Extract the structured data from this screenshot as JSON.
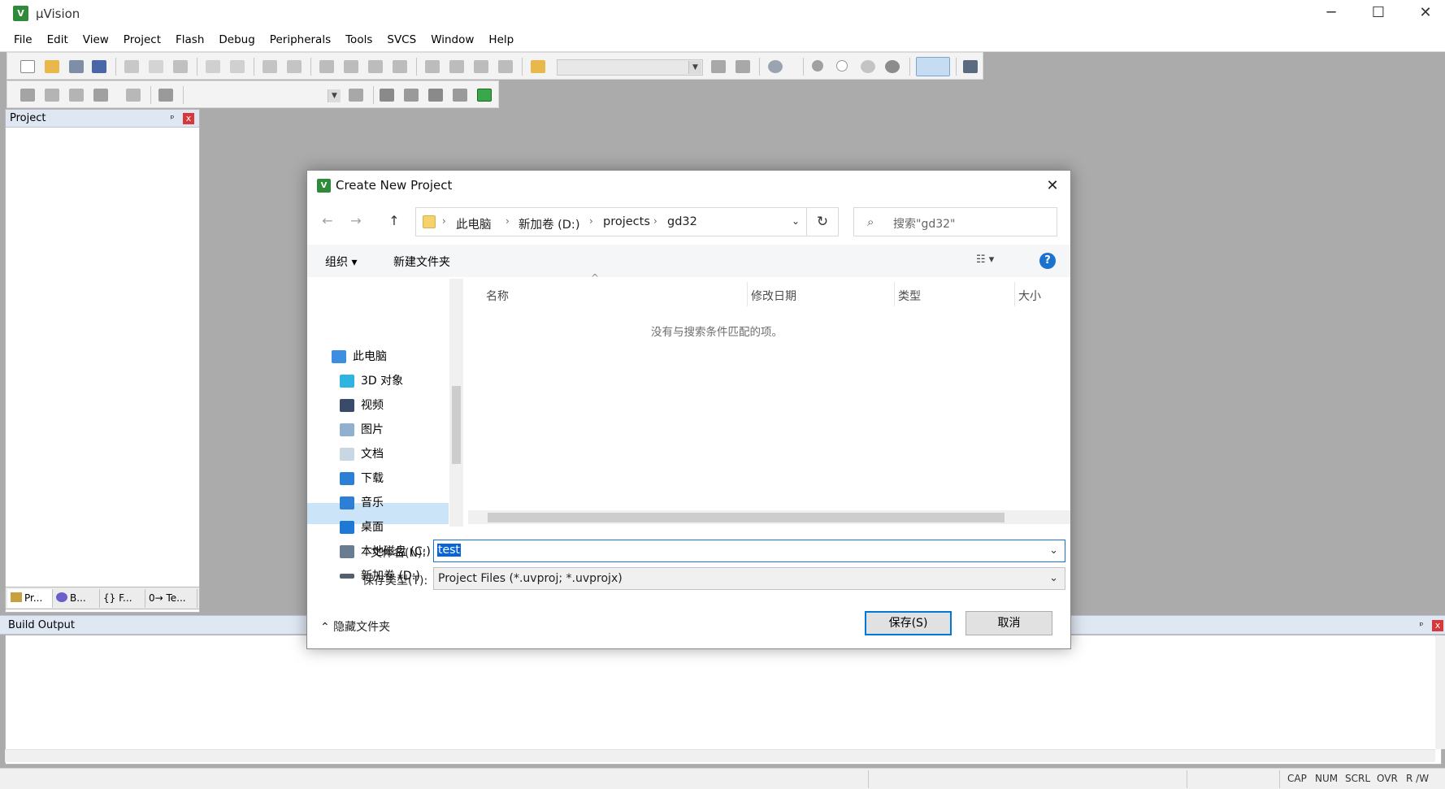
{
  "window": {
    "title": "µVision",
    "logo_text": "V"
  },
  "window_controls": {
    "minimize": "─",
    "maximize": "☐",
    "close": "✕"
  },
  "menu": [
    "File",
    "Edit",
    "View",
    "Project",
    "Flash",
    "Debug",
    "Peripherals",
    "Tools",
    "SVCS",
    "Window",
    "Help"
  ],
  "project_panel": {
    "title": "Project",
    "pin": "ᵖ",
    "close": "x",
    "tabs": [
      "Pr...",
      "B...",
      "{} F...",
      "0→ Te..."
    ]
  },
  "build_output": {
    "title": "Build Output",
    "pin": "ᵖ",
    "close": "x"
  },
  "status_bar": {
    "cap": "CAP",
    "num": "NUM",
    "scrl": "SCRL",
    "ovr": "OVR",
    "rw": "R /W"
  },
  "dialog": {
    "title": "Create New Project",
    "close": "✕",
    "nav": {
      "back": "←",
      "forward": "→",
      "up": "↑"
    },
    "breadcrumb": [
      "此电脑",
      "新加卷 (D:)",
      "projects",
      "gd32"
    ],
    "crumb_sep": "›",
    "dropdown": "⌄",
    "refresh": "↻",
    "search": {
      "icon": "⌕",
      "placeholder": "搜索\"gd32\""
    },
    "toolbar": {
      "organize": "组织 ▾",
      "new_folder": "新建文件夹",
      "view": "☷ ▾",
      "help": "?"
    },
    "nav_pane": [
      {
        "label": "此电脑",
        "icon": "computer-icon",
        "color": "#3b8ee0"
      },
      {
        "label": "3D 对象",
        "icon": "cube-3d-icon",
        "color": "#2fb3e0"
      },
      {
        "label": "视频",
        "icon": "video-icon",
        "color": "#3a4a6a"
      },
      {
        "label": "图片",
        "icon": "picture-icon",
        "color": "#8fb0d0"
      },
      {
        "label": "文档",
        "icon": "document-icon",
        "color": "#c9d6e4"
      },
      {
        "label": "下载",
        "icon": "download-icon",
        "color": "#2d7fd6"
      },
      {
        "label": "音乐",
        "icon": "music-icon",
        "color": "#2d7fd6"
      },
      {
        "label": "桌面",
        "icon": "desktop-icon",
        "color": "#1e78d6"
      },
      {
        "label": "本地磁盘 (C:)",
        "icon": "drive-c-icon",
        "color": "#6a7c92"
      },
      {
        "label": "新加卷 (D:)",
        "icon": "drive-d-icon",
        "color": "#55606c"
      }
    ],
    "columns": [
      "名称",
      "修改日期",
      "类型",
      "大小"
    ],
    "sort_caret": "^",
    "empty_message": "没有与搜索条件匹配的项。",
    "filename_label": "文件名(N):",
    "filename_value": "test",
    "filetype_label": "保存类型(T):",
    "filetype_value": "Project Files (*.uvproj; *.uvprojx)",
    "hide_folders": "⌃ 隐藏文件夹",
    "save": "保存(S)",
    "cancel": "取消"
  }
}
